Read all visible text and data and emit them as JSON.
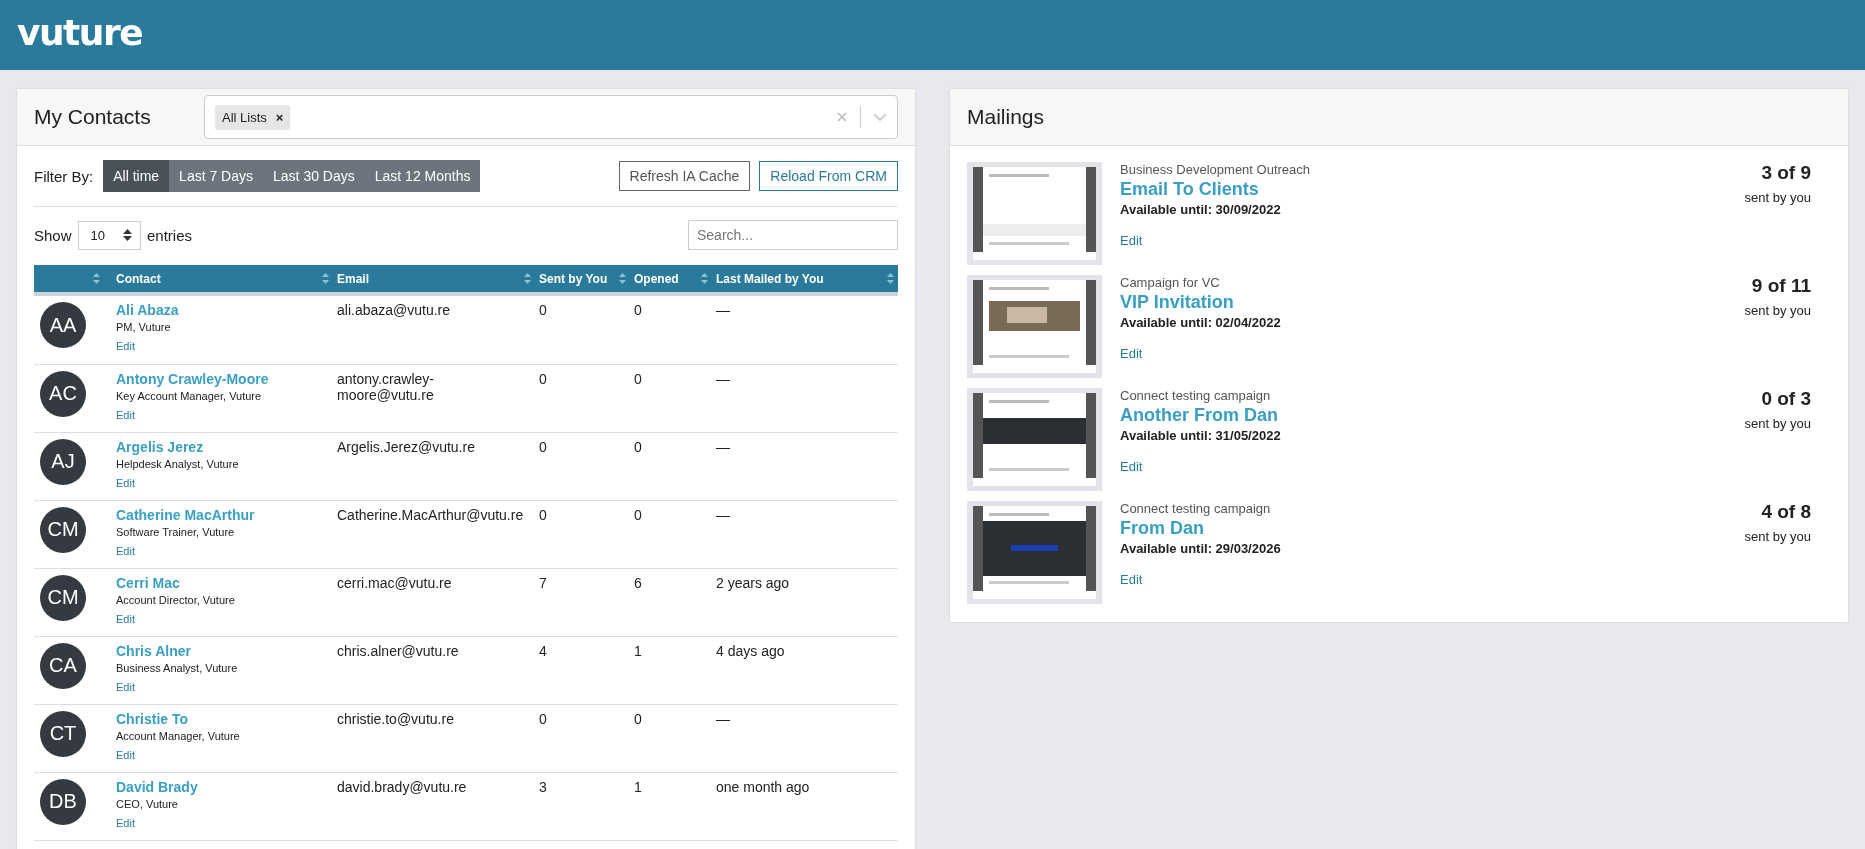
{
  "header": {
    "logo": "vuture"
  },
  "contacts": {
    "title": "My Contacts",
    "list_filter": {
      "tags": [
        {
          "label": "All Lists",
          "remove": "×"
        }
      ]
    },
    "filter_label": "Filter By:",
    "filters": [
      {
        "label": "All time",
        "selected": true
      },
      {
        "label": "Last 7 Days",
        "selected": false
      },
      {
        "label": "Last 30 Days",
        "selected": false
      },
      {
        "label": "Last 12 Months",
        "selected": false
      }
    ],
    "actions": [
      {
        "label": "Refresh IA Cache",
        "kind": "default"
      },
      {
        "label": "Reload From CRM",
        "kind": "primary"
      }
    ],
    "show": {
      "before": "Show",
      "value": "10",
      "after": "entries"
    },
    "search": {
      "placeholder": "Search..."
    },
    "columns": [
      "Contact",
      "Email",
      "Sent by You",
      "Opened",
      "Last Mailed by You"
    ],
    "rows": [
      {
        "initials": "AA",
        "name": "Ali Abaza",
        "role": "PM, Vuture",
        "edit": "Edit",
        "email": "ali.abaza@vutu.re",
        "sent": "0",
        "opened": "0",
        "last": "—"
      },
      {
        "initials": "AC",
        "name": "Antony Crawley-Moore",
        "role": "Key Account Manager, Vuture",
        "edit": "Edit",
        "email": "antony.crawley-moore@vutu.re",
        "sent": "0",
        "opened": "0",
        "last": "—"
      },
      {
        "initials": "AJ",
        "name": "Argelis Jerez",
        "role": "Helpdesk Analyst, Vuture",
        "edit": "Edit",
        "email": "Argelis.Jerez@vutu.re",
        "sent": "0",
        "opened": "0",
        "last": "—"
      },
      {
        "initials": "CM",
        "name": "Catherine MacArthur",
        "role": "Software Trainer, Vuture",
        "edit": "Edit",
        "email": "Catherine.MacArthur@vutu.re",
        "sent": "0",
        "opened": "0",
        "last": "—"
      },
      {
        "initials": "CM",
        "name": "Cerri Mac",
        "role": "Account Director, Vuture",
        "edit": "Edit",
        "email": "cerri.mac@vutu.re",
        "sent": "7",
        "opened": "6",
        "last": "2 years ago"
      },
      {
        "initials": "CA",
        "name": "Chris Alner",
        "role": "Business Analyst, Vuture",
        "edit": "Edit",
        "email": "chris.alner@vutu.re",
        "sent": "4",
        "opened": "1",
        "last": "4 days ago"
      },
      {
        "initials": "CT",
        "name": "Christie To",
        "role": "Account Manager, Vuture",
        "edit": "Edit",
        "email": "christie.to@vutu.re",
        "sent": "0",
        "opened": "0",
        "last": "—"
      },
      {
        "initials": "DB",
        "name": "David Brady",
        "role": "CEO, Vuture",
        "edit": "Edit",
        "email": "david.brady@vutu.re",
        "sent": "3",
        "opened": "1",
        "last": "one month ago"
      }
    ]
  },
  "mailings": {
    "title": "Mailings",
    "items": [
      {
        "campaign": "Business Development Outreach",
        "name": "Email To Clients",
        "available": "Available until: 30/09/2022",
        "edit": "Edit",
        "count": "3 of 9",
        "count_note": "sent by you"
      },
      {
        "campaign": "Campaign for VC",
        "name": "VIP Invitation",
        "available": "Available until: 02/04/2022",
        "edit": "Edit",
        "count": "9 of 11",
        "count_note": "sent by you"
      },
      {
        "campaign": "Connect testing campaign",
        "name": "Another From Dan",
        "available": "Available until: 31/05/2022",
        "edit": "Edit",
        "count": "0 of 3",
        "count_note": "sent by you"
      },
      {
        "campaign": "Connect testing campaign",
        "name": "From Dan",
        "available": "Available until: 29/03/2026",
        "edit": "Edit",
        "count": "4 of 8",
        "count_note": "sent by you"
      }
    ]
  }
}
